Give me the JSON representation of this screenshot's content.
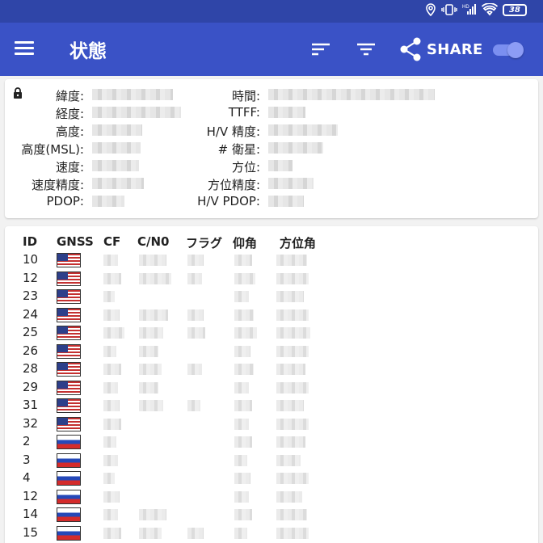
{
  "status_bar": {
    "icons": [
      "location-icon",
      "vibrate-icon",
      "signal-icon",
      "wifi-icon"
    ],
    "battery": "38"
  },
  "app_bar": {
    "title": "状態",
    "share_label": "SHARE",
    "toggle_on": true,
    "accent": "#3a52c6"
  },
  "location": {
    "labels_left": [
      "緯度:",
      "経度:",
      "高度:",
      "高度(MSL):",
      "速度:",
      "速度精度:",
      "PDOP:"
    ],
    "labels_right": [
      "時間:",
      "TTFF:",
      "H/V 精度:",
      "# 衛星:",
      "方位:",
      "方位精度:",
      "H/V PDOP:"
    ]
  },
  "satellites": {
    "columns": [
      "ID",
      "GNSS",
      "CF",
      "C/N0",
      "フラグ",
      "仰角",
      "方位角"
    ],
    "rows": [
      {
        "id": "10",
        "gnss": "us"
      },
      {
        "id": "12",
        "gnss": "us"
      },
      {
        "id": "23",
        "gnss": "us"
      },
      {
        "id": "24",
        "gnss": "us"
      },
      {
        "id": "25",
        "gnss": "us"
      },
      {
        "id": "26",
        "gnss": "us"
      },
      {
        "id": "28",
        "gnss": "us"
      },
      {
        "id": "29",
        "gnss": "us"
      },
      {
        "id": "31",
        "gnss": "us"
      },
      {
        "id": "32",
        "gnss": "us"
      },
      {
        "id": "2",
        "gnss": "ru"
      },
      {
        "id": "3",
        "gnss": "ru"
      },
      {
        "id": "4",
        "gnss": "ru"
      },
      {
        "id": "12",
        "gnss": "ru"
      },
      {
        "id": "14",
        "gnss": "ru"
      },
      {
        "id": "15",
        "gnss": "ru"
      }
    ]
  }
}
